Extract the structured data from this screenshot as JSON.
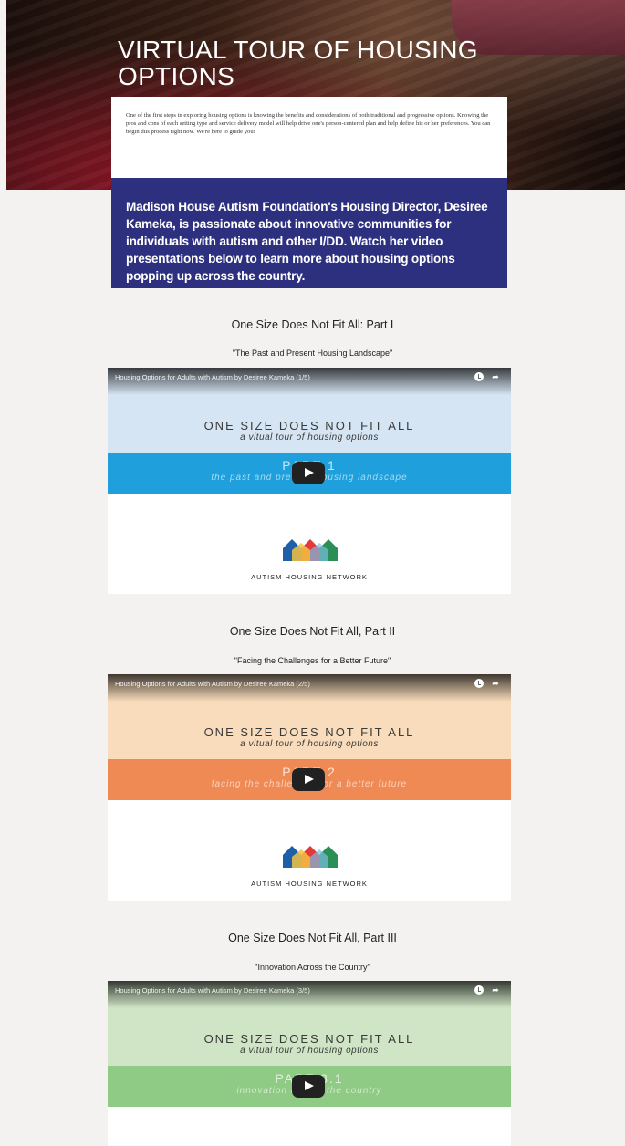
{
  "hero": {
    "title_line1": "VIRTUAL TOUR OF HOUSING",
    "title_line2": "OPTIONS",
    "intro": "One of the first steps in exploring housing options is knowing the benefits and considerations of both traditional and progressive options. Knowing the pros and cons of each setting type and service delivery model will help drive one's person-centered plan and help define his or her preferences. You can begin this process right now. We're here to guide you!",
    "highlight": "Madison House Autism Foundation's Housing Director, Desiree Kameka, is passionate about innovative communities for individuals with autism and other I/DD. Watch her video presentations below to learn more about housing options popping up across the country."
  },
  "sections": [
    {
      "title": "One Size Does Not Fit All: Part I",
      "subtitle": "\"The Past and Present Housing Landscape\"",
      "video_title": "Housing Options for Adults with Autism by Desiree Kameka (1/5)",
      "big_title": "ONE SIZE DOES NOT FIT ALL",
      "big_sub": "a vitual tour of housing options",
      "part": "PART 1",
      "band_sub": "the past and present housing landscape",
      "logo_text": "AUTISM HOUSING NETWORK",
      "colors": {
        "top": "#d6e5f3",
        "band": "#1fa0dc"
      }
    },
    {
      "title": "One Size Does Not Fit All, Part II",
      "subtitle": "\"Facing the Challenges for a Better Future\"",
      "video_title": "Housing Options for Adults with Autism by Desiree Kameka (2/5)",
      "big_title": "ONE SIZE DOES NOT FIT ALL",
      "big_sub": "a vitual tour of housing options",
      "part": "PART 2",
      "band_sub": "facing the challenges for a better future",
      "logo_text": "AUTISM HOUSING NETWORK",
      "colors": {
        "top": "#f8dcbb",
        "band": "#f08a55"
      }
    },
    {
      "title": "One Size Does Not Fit All, Part III",
      "subtitle": "\"Innovation Across the Country\"",
      "video_title": "Housing Options for Adults with Autism by Desiree Kameka (3/5)",
      "big_title": "ONE SIZE DOES NOT FIT ALL",
      "big_sub": "a vitual tour of housing options",
      "part": "PART 3.1",
      "band_sub": "innovation across the country",
      "colors": {
        "top": "#cfe5c5",
        "band": "#8fcb84"
      }
    }
  ],
  "icons": {
    "play": "play-icon",
    "clock": "watch-later-icon",
    "share": "share-icon",
    "logo": "house-logo-icon"
  }
}
